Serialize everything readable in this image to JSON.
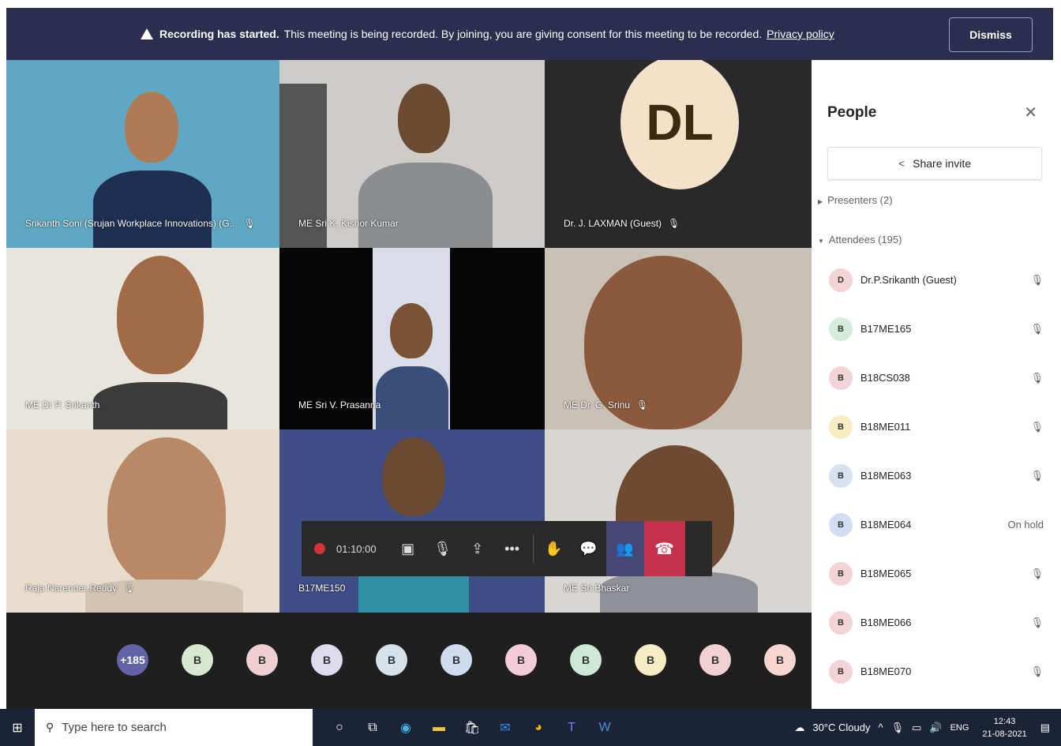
{
  "banner": {
    "bold": "Recording has started.",
    "text": "This meeting is being recorded. By joining, you are giving consent for this meeting to be recorded.",
    "link": "Privacy policy",
    "dismiss": "Dismiss"
  },
  "tiles": [
    {
      "name": "Srikanth Soni (Srujan Workplace Innovations) (G..."
    },
    {
      "name": "ME Sri K. Kishor Kumar"
    },
    {
      "name": "Dr. J. LAXMAN (Guest)",
      "initials": "DL"
    },
    {
      "name": "ME Dr P. Srikanth"
    },
    {
      "name": "ME Sri V. Prasanna"
    },
    {
      "name": "ME Dr. G. Srinu"
    },
    {
      "name": "Raja Narender Reddy"
    },
    {
      "name": "B17ME150"
    },
    {
      "name": "ME Sri Bhaskar"
    }
  ],
  "controls": {
    "timer": "01:10:00"
  },
  "strip": [
    "+185",
    "B",
    "B",
    "B",
    "B",
    "B",
    "B",
    "B",
    "B",
    "B",
    "B"
  ],
  "panel": {
    "title": "People",
    "share": "Share invite",
    "presenters": "Presenters (2)",
    "attendees": "Attendees (195)",
    "rows": [
      {
        "initial": "D",
        "name": "Dr.P.Srikanth (Guest)",
        "status": ""
      },
      {
        "initial": "B",
        "name": "B17ME165",
        "status": ""
      },
      {
        "initial": "B",
        "name": "B18CS038",
        "status": ""
      },
      {
        "initial": "B",
        "name": "B18ME011",
        "status": ""
      },
      {
        "initial": "B",
        "name": "B18ME063",
        "status": ""
      },
      {
        "initial": "B",
        "name": "B18ME064",
        "status": "On hold"
      },
      {
        "initial": "B",
        "name": "B18ME065",
        "status": ""
      },
      {
        "initial": "B",
        "name": "B18ME066",
        "status": ""
      },
      {
        "initial": "B",
        "name": "B18ME070",
        "status": ""
      }
    ]
  },
  "taskbar": {
    "search_placeholder": "Type here to search",
    "weather": "30°C  Cloudy",
    "lang": "ENG",
    "time": "12:43",
    "date": "21-08-2021"
  },
  "colors": {
    "banner": "#2b2e4f",
    "accent": "#464775",
    "leave": "#c4314b",
    "record": "#d13438"
  }
}
